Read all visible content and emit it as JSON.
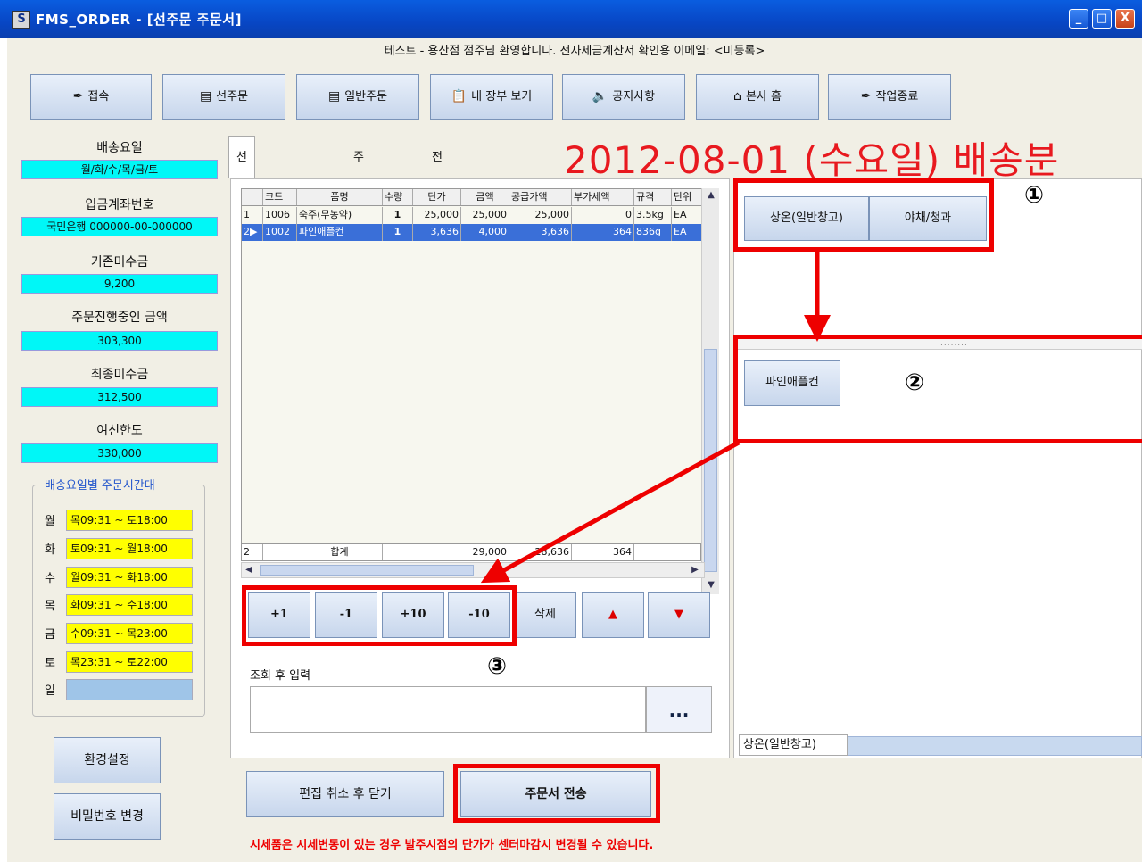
{
  "window": {
    "title": "FMS_ORDER - [선주문 주문서]",
    "controls": [
      "_",
      "□",
      "X"
    ]
  },
  "welcome": "테스트 - 용산점 점주님 환영합니다.   전자세금계산서 확인용 이메일: <미등록>",
  "toolbar": [
    {
      "label": "접속",
      "icon": "connect-icon",
      "glyph": "✒"
    },
    {
      "label": "선주문",
      "icon": "form-icon",
      "glyph": "▤"
    },
    {
      "label": "일반주문",
      "icon": "form-icon",
      "glyph": "▤"
    },
    {
      "label": "내 장부 보기",
      "icon": "ledger-icon",
      "glyph": "📋"
    },
    {
      "label": "공지사항",
      "icon": "speaker-icon",
      "glyph": "🔈"
    },
    {
      "label": "본사 홈",
      "icon": "home-icon",
      "glyph": "⌂"
    },
    {
      "label": "작업종료",
      "icon": "exit-icon",
      "glyph": "✒"
    }
  ],
  "sidebar": {
    "fields": [
      {
        "label": "배송요일",
        "value": "월/화/수/목/금/토"
      },
      {
        "label": "입금계좌번호",
        "value": "국민은행 000000-00-000000"
      },
      {
        "label": "기존미수금",
        "value": "9,200"
      },
      {
        "label": "주문진행중인 금액",
        "value": "303,300"
      },
      {
        "label": "최종미수금",
        "value": "312,500"
      },
      {
        "label": "여신한도",
        "value": "330,000"
      }
    ],
    "schedule_title": "배송요일별 주문시간대",
    "schedule": [
      {
        "day": "월",
        "value": "목09:31 ~ 토18:00"
      },
      {
        "day": "화",
        "value": "토09:31 ~ 월18:00"
      },
      {
        "day": "수",
        "value": "월09:31 ~ 화18:00"
      },
      {
        "day": "목",
        "value": "화09:31 ~ 수18:00"
      },
      {
        "day": "금",
        "value": "수09:31 ~ 목23:00"
      },
      {
        "day": "토",
        "value": "목23:31 ~ 토22:00"
      },
      {
        "day": "일",
        "value": ""
      }
    ],
    "settings_label": "환경설정",
    "password_label": "비밀번호 변경"
  },
  "tabs": [
    "선주문 주문서",
    "주문없음",
    "전달하고 싶은 말"
  ],
  "date_title": "2012-08-01 (수요일) 배송분",
  "grid": {
    "headers": [
      "",
      "코드",
      "품명",
      "수량",
      "단가",
      "금액",
      "공급가액",
      "부가세액",
      "규격",
      "단위"
    ],
    "rows": [
      [
        "1",
        "1006",
        "숙주(무농약)",
        "1",
        "25,000",
        "25,000",
        "25,000",
        "0",
        "3.5kg",
        "EA"
      ],
      [
        "2▶",
        "1002",
        "파인애플컨",
        "1",
        "3,636",
        "4,000",
        "3,636",
        "364",
        "836g",
        "EA"
      ]
    ],
    "summary": {
      "count": "2",
      "label": "합계",
      "amount": "29,000",
      "supply": "28,636",
      "tax": "364"
    }
  },
  "qty_buttons": [
    "+1",
    "-1",
    "+10",
    "-10"
  ],
  "delete_label": "삭제",
  "up_label": "▲",
  "down_label": "▼",
  "lookup": {
    "label": "조회 후 입력",
    "value": "",
    "button": "..."
  },
  "categories": [
    "상온(일반창고)",
    "야채/청과"
  ],
  "product_button": "파인애플컨",
  "bottom_tab": "상온(일반창고)",
  "actions": {
    "cancel_close": "편집 취소 후 닫기",
    "send_order": "주문서 전송"
  },
  "notice": "시세품은 시세변동이 있는 경우 발주시점의 단가가 센터마감시 변경될 수 있습니다.",
  "markers": [
    "①",
    "②",
    "③"
  ],
  "colors": {
    "highlight": "#e00000",
    "value_bg": "#00f7f7",
    "schedule_bg": "#ffff00",
    "date_title": "#e8191f"
  }
}
